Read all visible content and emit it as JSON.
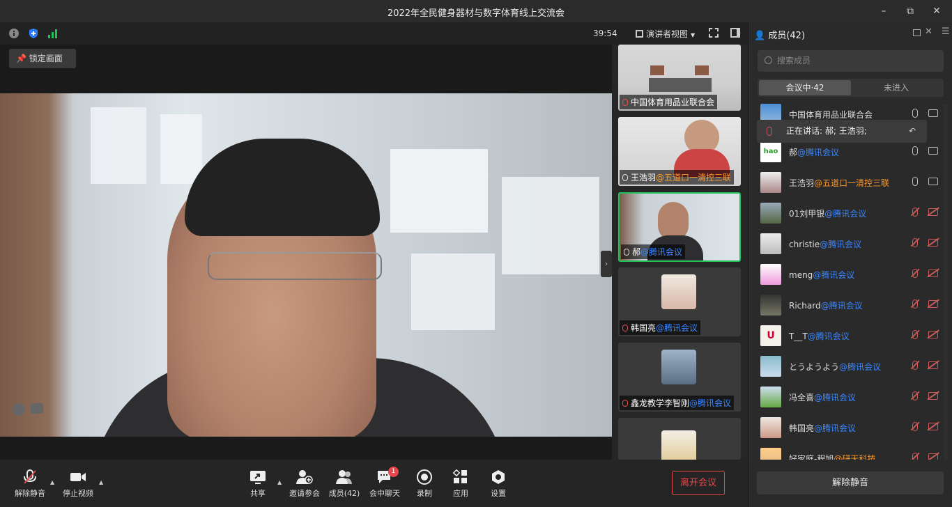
{
  "window": {
    "title": "2022年全民健身器材与数字体育线上交流会"
  },
  "topbar": {
    "timer": "39:54",
    "view_label": "演讲者视图"
  },
  "main": {
    "lock_label": "锁定画面"
  },
  "thumbs": [
    {
      "name": "中国体育用品业联合会",
      "org": "",
      "muted": true
    },
    {
      "name": "王浩羽",
      "org": "@五道口一清控三联",
      "muted": false
    },
    {
      "name": "郝",
      "org": "@腾讯会议",
      "muted": false
    },
    {
      "name": "韩国亮",
      "org": "@腾讯会议",
      "muted": true
    },
    {
      "name": "鑫龙教学李智刚",
      "org": "@腾讯会议",
      "muted": true
    }
  ],
  "toolbar": {
    "unmute": "解除静音",
    "stop_video": "停止视频",
    "share": "共享",
    "invite": "邀请参会",
    "members": "成员(42)",
    "chat": "会中聊天",
    "chat_badge": "1",
    "record": "录制",
    "apps": "应用",
    "settings": "设置",
    "leave": "离开会议"
  },
  "panel": {
    "title": "成员(42)",
    "search_placeholder": "搜索成员",
    "tab_in": "会议中·42",
    "tab_out": "未进入",
    "speaking": "正在讲话: 郝; 王浩羽;",
    "unmute_all": "解除静音",
    "members": [
      {
        "name": "中国体育用品业联合会",
        "org": "",
        "mic": "on",
        "cam": "on"
      },
      {
        "name": "郝",
        "org": "@腾讯会议",
        "mic": "on",
        "cam": "on"
      },
      {
        "name": "王浩羽",
        "org": "@五道口一清控三联",
        "mic": "on",
        "cam": "on"
      },
      {
        "name": "01刘甲银",
        "org": "@腾讯会议",
        "mic": "off",
        "cam": "off"
      },
      {
        "name": "christie",
        "org": "@腾讯会议",
        "mic": "off",
        "cam": "off"
      },
      {
        "name": "meng",
        "org": "@腾讯会议",
        "mic": "off",
        "cam": "off"
      },
      {
        "name": "Richard",
        "org": "@腾讯会议",
        "mic": "off",
        "cam": "off"
      },
      {
        "name": "T__T",
        "org": "@腾讯会议",
        "mic": "off",
        "cam": "off"
      },
      {
        "name": "とうようよう",
        "org": "@腾讯会议",
        "mic": "off",
        "cam": "off"
      },
      {
        "name": "冯全喜",
        "org": "@腾讯会议",
        "mic": "off",
        "cam": "off"
      },
      {
        "name": "韩国亮",
        "org": "@腾讯会议",
        "mic": "off",
        "cam": "off"
      },
      {
        "name": "好家庭-程旭",
        "org": "@研天科技",
        "mic": "off",
        "cam": "off"
      }
    ]
  },
  "colors": {
    "accent": "#3a86ff",
    "active_border": "#23c15a",
    "danger": "#e5484d",
    "org_orange": "#ff9a2e"
  }
}
